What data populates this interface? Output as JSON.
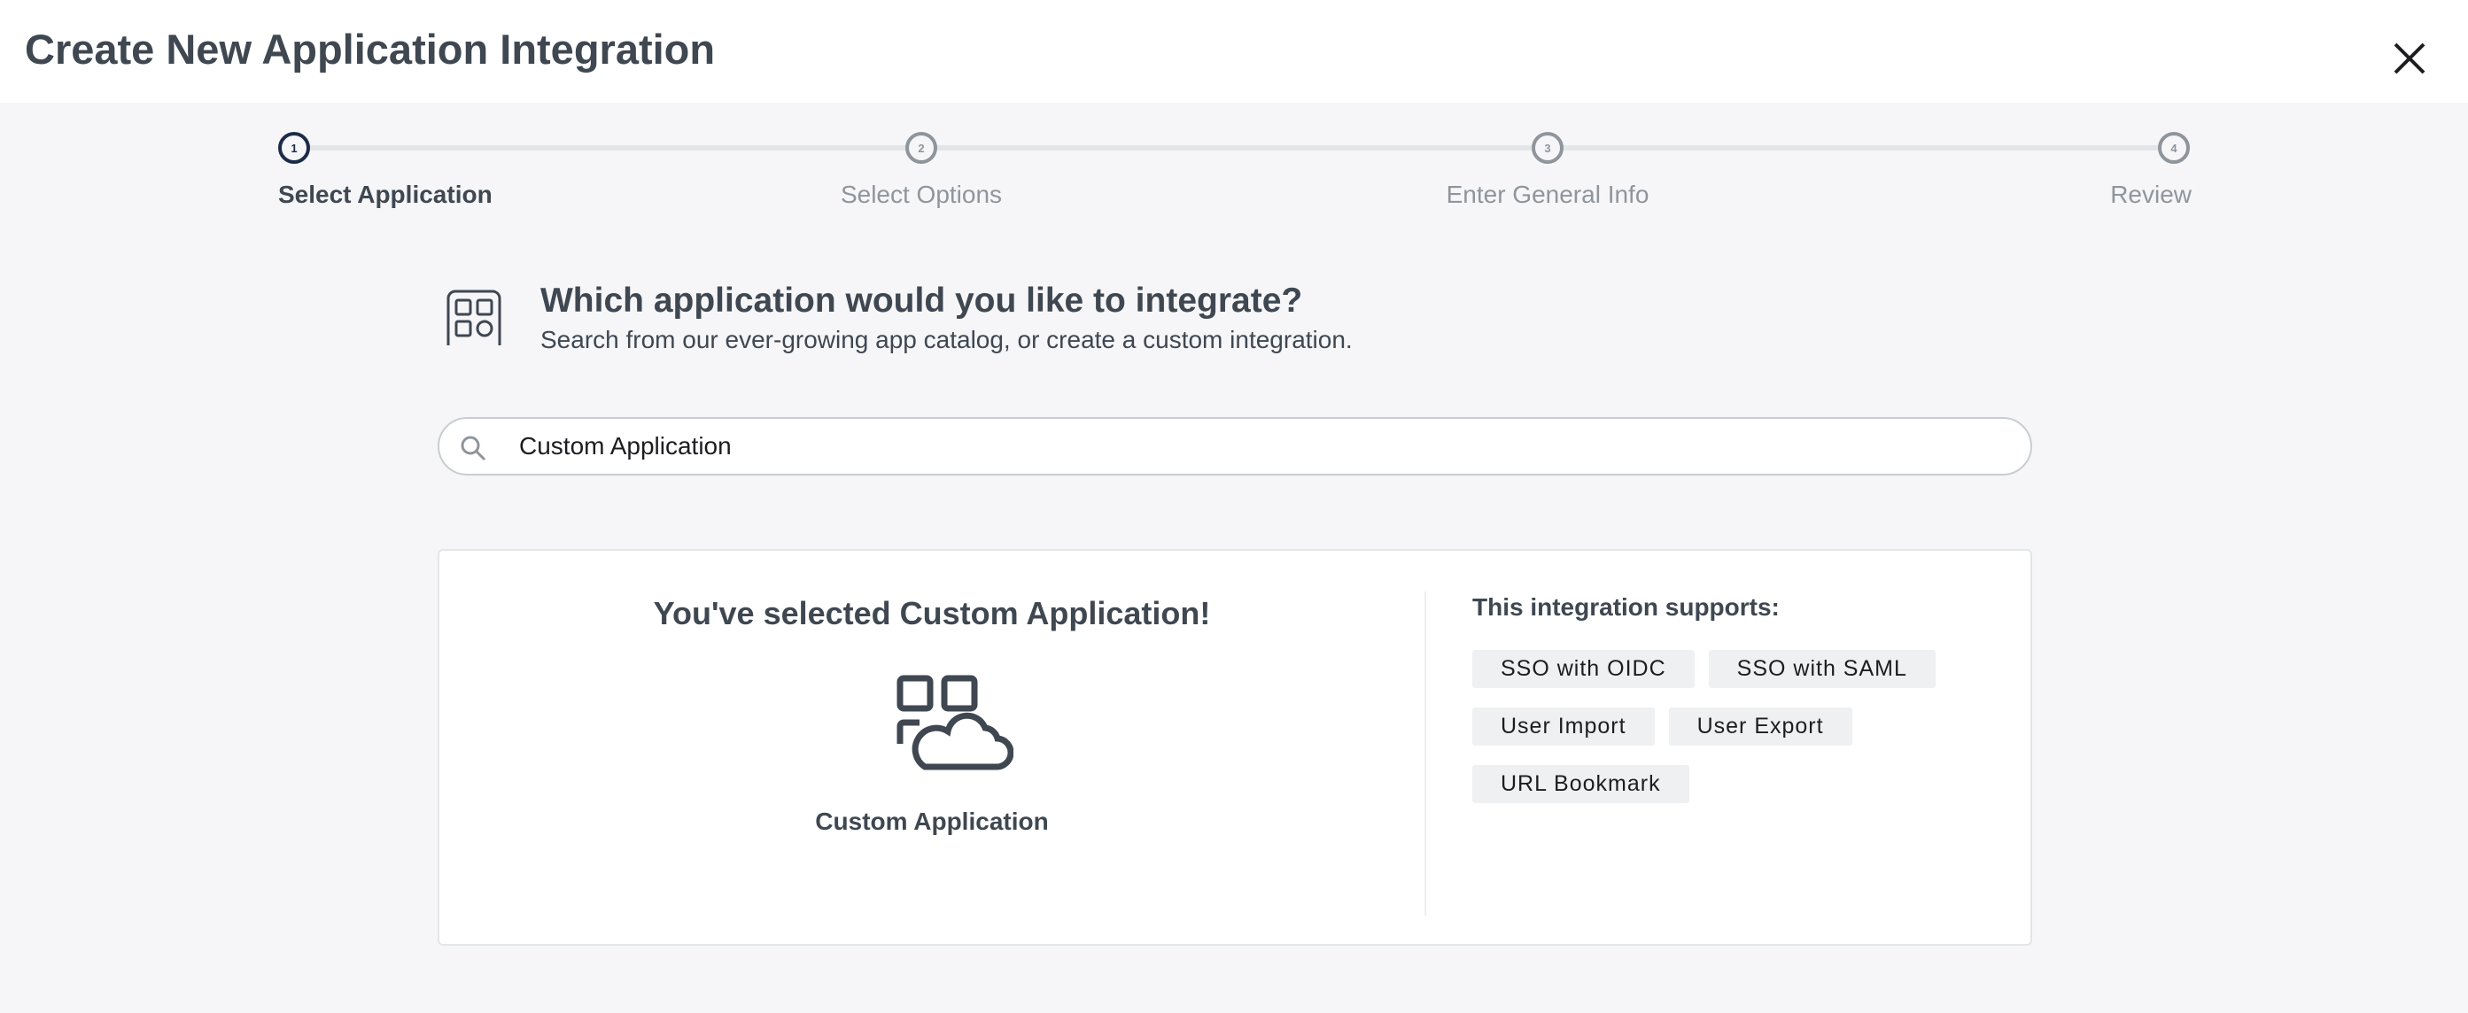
{
  "header": {
    "title": "Create New Application Integration",
    "close_icon": "close-icon"
  },
  "stepper": {
    "current_step": 1,
    "steps": [
      {
        "number": "1",
        "label": "Select Application"
      },
      {
        "number": "2",
        "label": "Select Options"
      },
      {
        "number": "3",
        "label": "Enter General Info"
      },
      {
        "number": "4",
        "label": "Review"
      }
    ]
  },
  "question": {
    "icon": "app-grid-icon",
    "heading": "Which application would you like to integrate?",
    "subtitle": "Search from our ever-growing app catalog, or create a custom integration."
  },
  "search": {
    "icon": "search-icon",
    "value": "Custom Application"
  },
  "selection": {
    "title": "You've selected Custom Application!",
    "app_icon": "custom-app-cloud-icon",
    "app_name": "Custom Application",
    "supports_title": "This integration supports:",
    "features": [
      "SSO with OIDC",
      "SSO with SAML",
      "User Import",
      "User Export",
      "URL Bookmark"
    ]
  },
  "colors": {
    "active_step": "#1c2c48",
    "inactive_step": "#8f959b",
    "text": "#3f4751",
    "background": "#f6f6f9"
  }
}
